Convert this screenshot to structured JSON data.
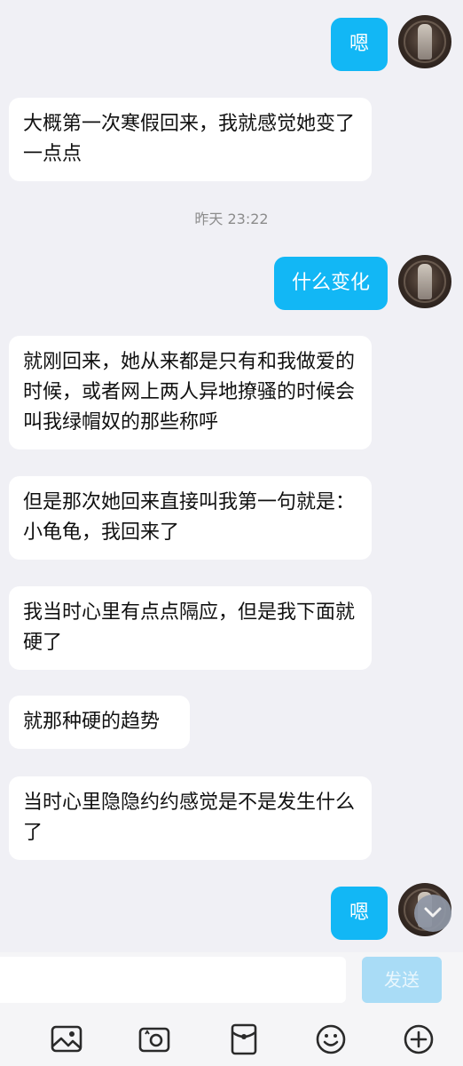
{
  "messages": [
    {
      "side": "out",
      "text": "嗯"
    },
    {
      "side": "in",
      "text": "大概第一次寒假回来，我就感觉她变了一点点"
    },
    {
      "timestamp": "昨天 23:22"
    },
    {
      "side": "out",
      "text": "什么变化"
    },
    {
      "side": "in",
      "text": "就刚回来，她从来都是只有和我做爱的时候，或者网上两人异地撩骚的时候会叫我绿帽奴的那些称呼"
    },
    {
      "side": "in",
      "text": "但是那次她回来直接叫我第一句就是：小龟龟，我回来了"
    },
    {
      "side": "in",
      "text": "我当时心里有点点隔应，但是我下面就硬了"
    },
    {
      "side": "in",
      "text": "就那种硬的趋势"
    },
    {
      "side": "in",
      "text": "当时心里隐隐约约感觉是不是发生什么了"
    },
    {
      "side": "out",
      "text": "嗯"
    }
  ],
  "input": {
    "value": "",
    "placeholder": ""
  },
  "send_label": "发送",
  "toolbar": {
    "icons": [
      "image-icon",
      "camera-icon",
      "red-packet-icon",
      "emoji-icon",
      "plus-icon"
    ]
  },
  "colors": {
    "outgoing_bubble": "#12b7f5",
    "incoming_bubble": "#ffffff",
    "background": "#f0f0f5",
    "send_button_disabled": "#a9dcf6"
  }
}
